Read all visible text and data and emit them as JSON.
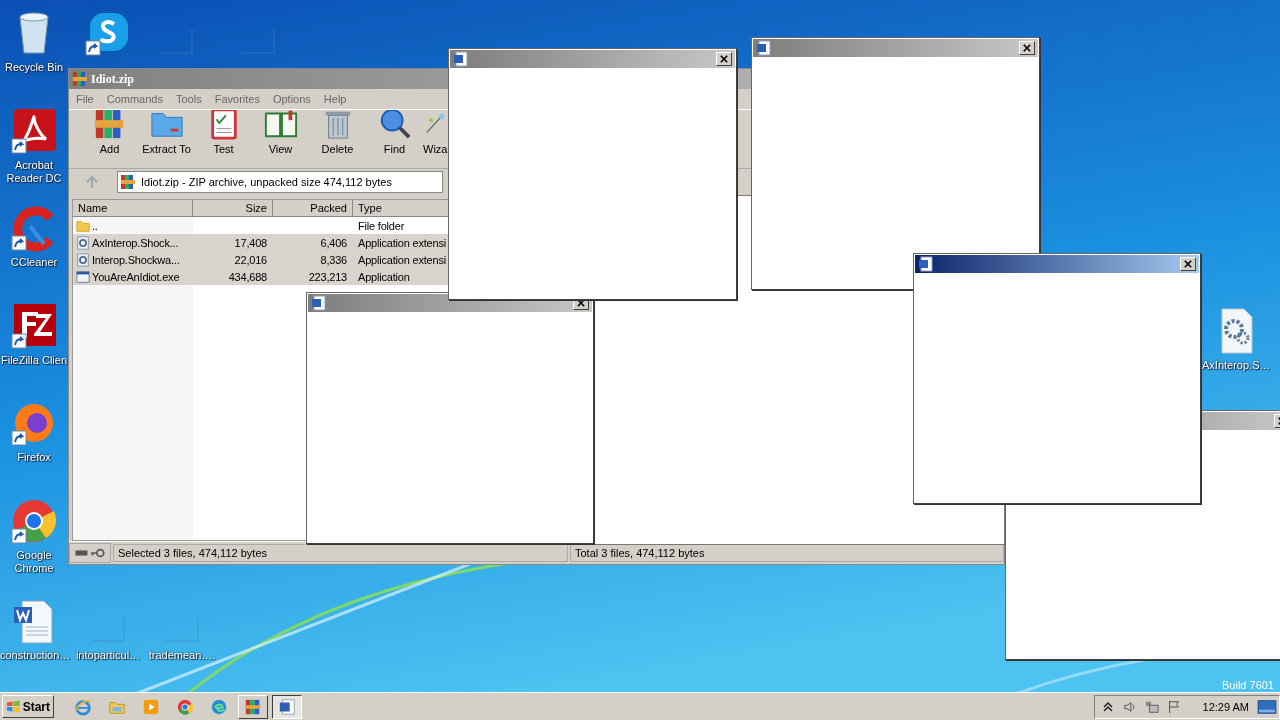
{
  "desktop_icons": [
    {
      "label": "Recycle Bin",
      "kind": "recycle",
      "shortcut": false
    },
    {
      "kind": "skype",
      "shortcut": true
    },
    {
      "kind": "blank",
      "shortcut": false
    },
    {
      "kind": "blank",
      "shortcut": false
    },
    {
      "label": "Acrobat Reader DC",
      "kind": "acrobat",
      "shortcut": true
    },
    {
      "label": "CCleaner",
      "kind": "ccleaner",
      "shortcut": true
    },
    {
      "label": "FileZilla Clien",
      "kind": "filezilla",
      "shortcut": true
    },
    {
      "label": "Firefox",
      "kind": "firefox",
      "shortcut": true
    },
    {
      "label": "Google Chrome",
      "kind": "chrome",
      "shortcut": true
    },
    {
      "label": "construction…",
      "kind": "worddoc",
      "shortcut": false
    },
    {
      "label": "intoparticul…",
      "kind": "blank",
      "shortcut": false
    },
    {
      "label": "trademean….",
      "kind": "blank",
      "shortcut": false
    },
    {
      "label": "AxInterop.S…",
      "kind": "gear",
      "shortcut": false
    }
  ],
  "archive_window": {
    "title": "Idiot.zip",
    "menu": [
      "File",
      "Commands",
      "Tools",
      "Favorites",
      "Options",
      "Help"
    ],
    "toolbar": [
      {
        "label": "Add",
        "kind": "add"
      },
      {
        "label": "Extract To",
        "kind": "extract"
      },
      {
        "label": "Test",
        "kind": "test"
      },
      {
        "label": "View",
        "kind": "view"
      },
      {
        "label": "Delete",
        "kind": "delete"
      },
      {
        "label": "Find",
        "kind": "find"
      },
      {
        "label": "Wiza",
        "kind": "wizard"
      }
    ],
    "address": "Idiot.zip - ZIP archive, unpacked size 474,112 bytes",
    "columns": [
      "Name",
      "Size",
      "Packed",
      "Type"
    ],
    "rows": [
      {
        "kind": "folder",
        "name": "..",
        "size": "",
        "packed": "",
        "type": "File folder",
        "selected": false
      },
      {
        "kind": "dll",
        "name": "AxInterop.Shock...",
        "size": "17,408",
        "packed": "6,406",
        "type": "Application extensi",
        "selected": true
      },
      {
        "kind": "dll",
        "name": "Interop.Shockwa...",
        "size": "22,016",
        "packed": "8,336",
        "type": "Application extensi",
        "selected": true
      },
      {
        "kind": "exe",
        "name": "YouAreAnIdiot.exe",
        "size": "434,688",
        "packed": "223,213",
        "type": "Application",
        "selected": true
      }
    ],
    "status_left": "Selected 3 files, 474,112 bytes",
    "status_right": "Total 3 files, 474,112 bytes"
  },
  "popups": [
    {
      "active": false
    },
    {
      "active": false
    },
    {
      "active": false
    },
    {
      "active": false
    },
    {
      "active": true
    }
  ],
  "build_text": "Build 7601",
  "taskbar": {
    "start": "Start",
    "apps": [
      {
        "kind": "ie",
        "running": false,
        "pressed": false
      },
      {
        "kind": "explorer",
        "running": false,
        "pressed": false
      },
      {
        "kind": "media",
        "running": false,
        "pressed": false
      },
      {
        "kind": "chrome",
        "running": false,
        "pressed": false
      },
      {
        "kind": "edge",
        "running": false,
        "pressed": false
      },
      {
        "kind": "winrar",
        "running": true,
        "pressed": false
      },
      {
        "kind": "word",
        "running": true,
        "pressed": true
      }
    ],
    "clock": "12:29 AM"
  }
}
